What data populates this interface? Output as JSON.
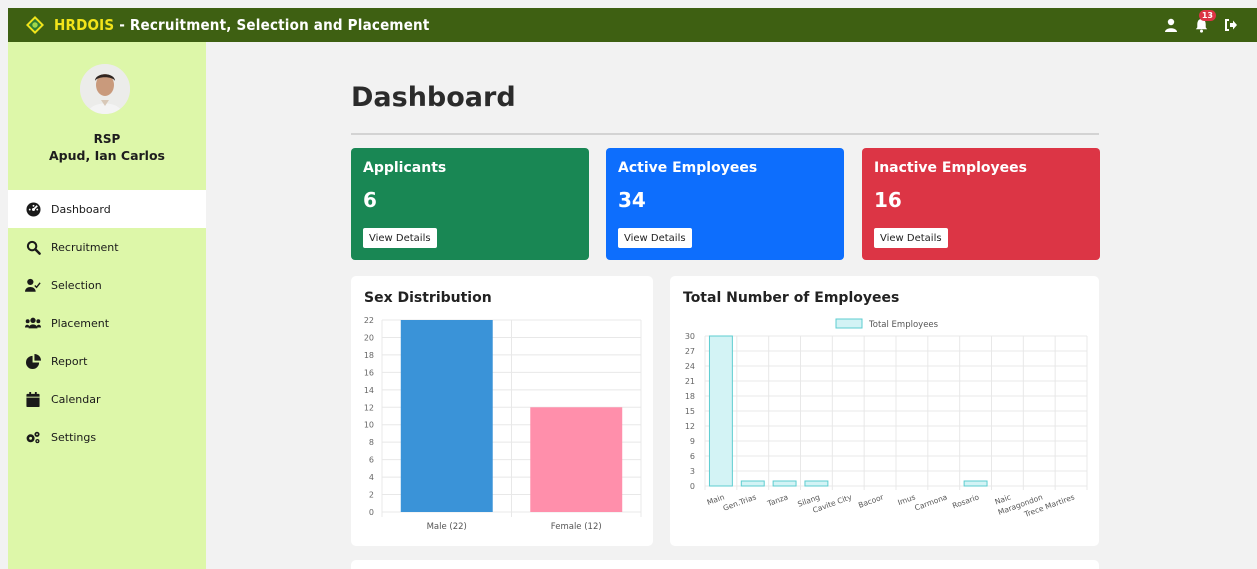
{
  "header": {
    "brand_acronym": "HRDOIS",
    "brand_rest": " - Recruitment, Selection and Placement",
    "notification_count": "13",
    "icons": [
      "user-icon",
      "bell-icon",
      "logout-icon"
    ]
  },
  "sidebar": {
    "role": "RSP",
    "name": "Apud, Ian Carlos",
    "items": [
      {
        "label": "Dashboard",
        "icon": "dashboard-icon",
        "active": true
      },
      {
        "label": "Recruitment",
        "icon": "search-icon"
      },
      {
        "label": "Selection",
        "icon": "user-check-icon"
      },
      {
        "label": "Placement",
        "icon": "users-icon"
      },
      {
        "label": "Report",
        "icon": "pie-chart-icon"
      },
      {
        "label": "Calendar",
        "icon": "calendar-icon"
      },
      {
        "label": "Settings",
        "icon": "gears-icon"
      }
    ]
  },
  "main": {
    "title": "Dashboard",
    "stats": [
      {
        "label": "Applicants",
        "value": "6",
        "button": "View Details",
        "color": "#198754"
      },
      {
        "label": "Active Employees",
        "value": "34",
        "button": "View Details",
        "color": "#0d6efd"
      },
      {
        "label": "Inactive Employees",
        "value": "16",
        "button": "View Details",
        "color": "#dc3545"
      }
    ]
  },
  "chart_data": [
    {
      "type": "bar",
      "title": "Sex Distribution",
      "categories": [
        "Male (22)",
        "Female (12)"
      ],
      "values": [
        22,
        12
      ],
      "colors": [
        "#3a93d8",
        "#ff8fab"
      ],
      "ylim": [
        0,
        22
      ],
      "yticks": [
        0,
        2,
        4,
        6,
        8,
        10,
        12,
        14,
        16,
        18,
        20,
        22
      ],
      "grid": true
    },
    {
      "type": "bar",
      "title": "Total Number of Employees",
      "categories": [
        "Main",
        "Gen.Trias",
        "Tanza",
        "Silang",
        "Cavite City",
        "Bacoor",
        "Imus",
        "Carmona",
        "Rosario",
        "Naic",
        "Maragondon",
        "Trece Martires"
      ],
      "series": [
        {
          "name": "Total Employees",
          "values": [
            30,
            1,
            1,
            1,
            0,
            0,
            0,
            0,
            1,
            0,
            0,
            0
          ]
        }
      ],
      "ylim": [
        0,
        30
      ],
      "yticks": [
        0,
        3,
        6,
        9,
        12,
        15,
        18,
        21,
        24,
        27,
        30
      ],
      "legend": "top",
      "fill": "#d3f3f5",
      "stroke": "#5ecdd0",
      "grid": true
    }
  ]
}
